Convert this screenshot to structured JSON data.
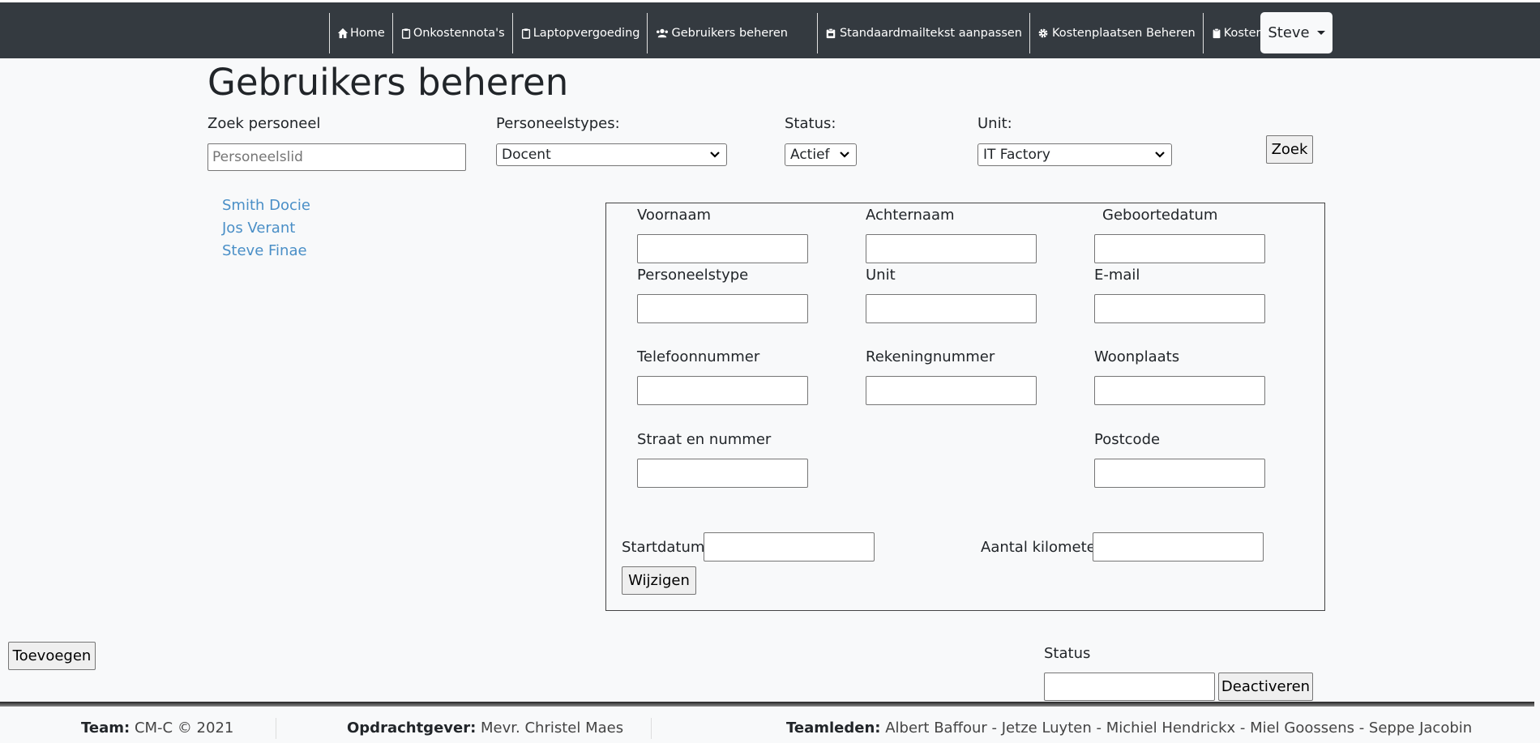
{
  "nav": {
    "items": [
      {
        "label": "Home",
        "icon": "home-icon"
      },
      {
        "label": "Onkostennota's",
        "icon": "clipboard-icon"
      },
      {
        "label": "Laptopvergoeding",
        "icon": "clipboard-icon"
      },
      {
        "label": "Gebruikers beheren",
        "icon": "users-icon"
      },
      {
        "label": "Standaardmailtekst aanpassen",
        "icon": "mail-icon"
      },
      {
        "label": "Kostenplaatsen Beheren",
        "icon": "gear-icon"
      },
      {
        "label": "Kosteninstellingen",
        "icon": "clipboard-icon"
      }
    ],
    "user": "Steve"
  },
  "page": {
    "title": "Gebruikers beheren"
  },
  "filters": {
    "search_label": "Zoek personeel",
    "search_placeholder": "Personeelslid",
    "type_label": "Personeelstypes:",
    "type_value": "Docent",
    "status_label": "Status:",
    "status_value": "Actief",
    "unit_label": "Unit:",
    "unit_value": "IT Factory",
    "search_button": "Zoek"
  },
  "users": [
    "Smith Docie",
    "Jos Verant",
    "Steve Finae"
  ],
  "form": {
    "voornaam": "Voornaam",
    "achternaam": "Achternaam",
    "geboortedatum": "Geboortedatum",
    "personeelstype": "Personeelstype",
    "unit": "Unit",
    "email": "E-mail",
    "telefoonnummer": "Telefoonnummer",
    "rekeningnummer": "Rekeningnummer",
    "woonplaats": "Woonplaats",
    "straat": "Straat en nummer",
    "postcode": "Postcode",
    "startdatum": "Startdatum:",
    "kilometer": "Aantal kilometer",
    "wijzigen": "Wijzigen"
  },
  "actions": {
    "toevoegen": "Toevoegen",
    "status_label": "Status",
    "deactiveren": "Deactiveren"
  },
  "footer": {
    "team_label": "Team:",
    "team_value": "CM-C © 2021",
    "client_label": "Opdrachtgever:",
    "client_value": "Mevr. Christel Maes",
    "members_label": "Teamleden:",
    "members_value": "Albert Baffour - Jetze Luyten - Michiel Hendrickx - Miel Goossens - Seppe Jacobin"
  },
  "colors": {
    "navbar": "#343a40",
    "link": "#4a8fc7",
    "background": "#f8f9fa"
  }
}
